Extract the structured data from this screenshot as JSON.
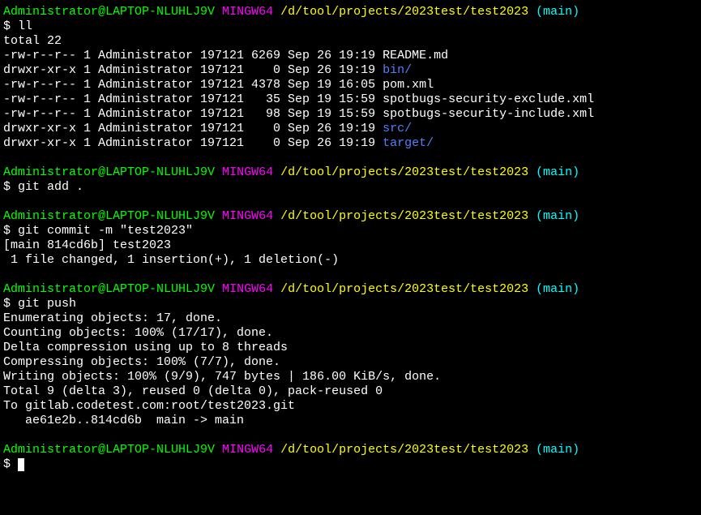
{
  "prompt": {
    "user_host": "Administrator@LAPTOP-NLUHLJ9V",
    "env": "MINGW64",
    "path": "/d/tool/projects/2023test/test2023",
    "branch": "(main)",
    "symbol": "$"
  },
  "blocks": [
    {
      "command": "ll",
      "output": [
        {
          "segments": [
            {
              "text": "total 22",
              "class": "white"
            }
          ]
        },
        {
          "segments": [
            {
              "text": "-rw-r--r-- 1 Administrator 197121 6269 Sep 26 19:19 ",
              "class": "white"
            },
            {
              "text": "README.md",
              "class": "white"
            }
          ]
        },
        {
          "segments": [
            {
              "text": "drwxr-xr-x 1 Administrator 197121    0 Sep 26 19:19 ",
              "class": "white"
            },
            {
              "text": "bin/",
              "class": "blue"
            }
          ]
        },
        {
          "segments": [
            {
              "text": "-rw-r--r-- 1 Administrator 197121 4378 Sep 19 16:05 ",
              "class": "white"
            },
            {
              "text": "pom.xml",
              "class": "white"
            }
          ]
        },
        {
          "segments": [
            {
              "text": "-rw-r--r-- 1 Administrator 197121   35 Sep 19 15:59 ",
              "class": "white"
            },
            {
              "text": "spotbugs-security-exclude.xml",
              "class": "white"
            }
          ]
        },
        {
          "segments": [
            {
              "text": "-rw-r--r-- 1 Administrator 197121   98 Sep 19 15:59 ",
              "class": "white"
            },
            {
              "text": "spotbugs-security-include.xml",
              "class": "white"
            }
          ]
        },
        {
          "segments": [
            {
              "text": "drwxr-xr-x 1 Administrator 197121    0 Sep 26 19:19 ",
              "class": "white"
            },
            {
              "text": "src/",
              "class": "blue"
            }
          ]
        },
        {
          "segments": [
            {
              "text": "drwxr-xr-x 1 Administrator 197121    0 Sep 26 19:19 ",
              "class": "white"
            },
            {
              "text": "target/",
              "class": "blue"
            }
          ]
        }
      ]
    },
    {
      "command": "git add .",
      "output": []
    },
    {
      "command": "git commit -m \"test2023\"",
      "output": [
        {
          "segments": [
            {
              "text": "[main 814cd6b] test2023",
              "class": "white"
            }
          ]
        },
        {
          "segments": [
            {
              "text": " 1 file changed, 1 insertion(+), 1 deletion(-)",
              "class": "white"
            }
          ]
        }
      ]
    },
    {
      "command": "git push",
      "output": [
        {
          "segments": [
            {
              "text": "Enumerating objects: 17, done.",
              "class": "white"
            }
          ]
        },
        {
          "segments": [
            {
              "text": "Counting objects: 100% (17/17), done.",
              "class": "white"
            }
          ]
        },
        {
          "segments": [
            {
              "text": "Delta compression using up to 8 threads",
              "class": "white"
            }
          ]
        },
        {
          "segments": [
            {
              "text": "Compressing objects: 100% (7/7), done.",
              "class": "white"
            }
          ]
        },
        {
          "segments": [
            {
              "text": "Writing objects: 100% (9/9), 747 bytes | 186.00 KiB/s, done.",
              "class": "white"
            }
          ]
        },
        {
          "segments": [
            {
              "text": "Total 9 (delta 3), reused 0 (delta 0), pack-reused 0",
              "class": "white"
            }
          ]
        },
        {
          "segments": [
            {
              "text": "To gitlab.codetest.com:root/test2023.git",
              "class": "white"
            }
          ]
        },
        {
          "segments": [
            {
              "text": "   ae61e2b..814cd6b  main -> main",
              "class": "white"
            }
          ]
        }
      ]
    }
  ]
}
